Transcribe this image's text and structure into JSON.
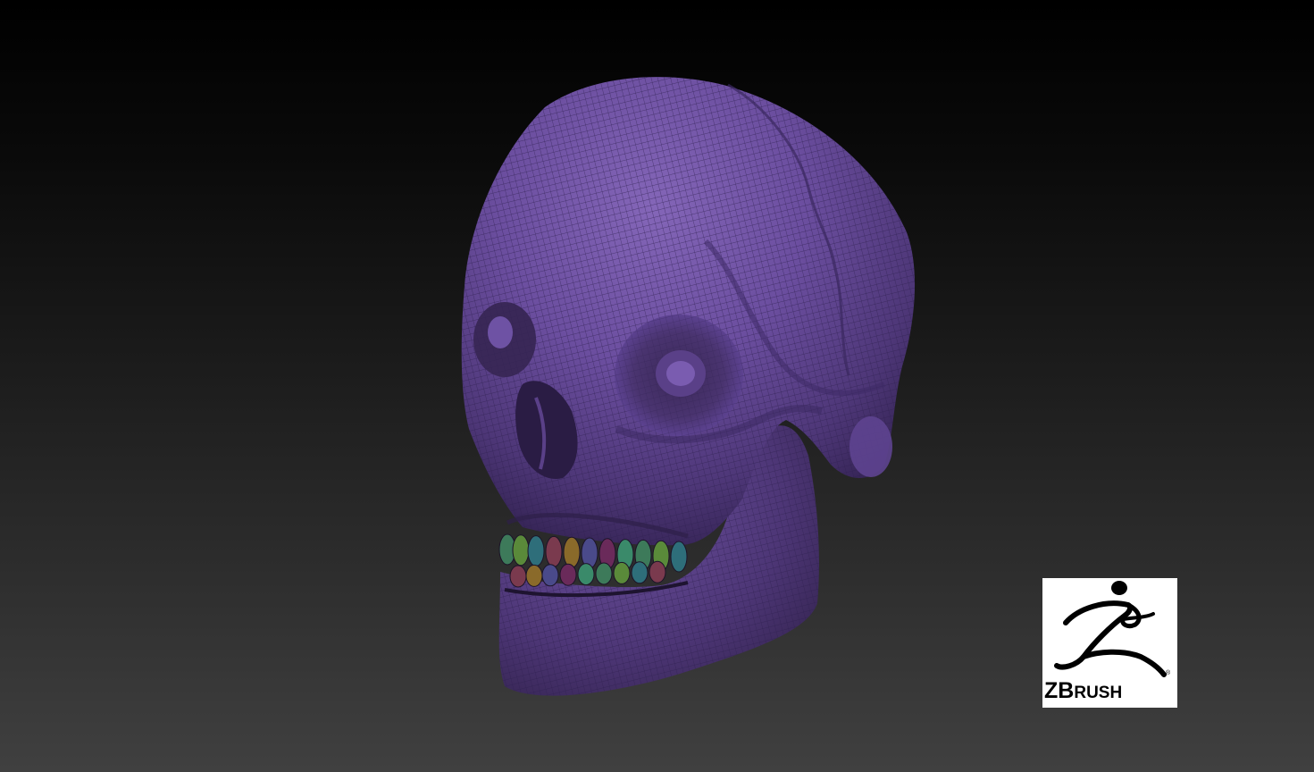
{
  "scene": {
    "background_top": "#000000",
    "background_bottom": "#404040",
    "model": {
      "subject": "human skull",
      "material_color": "#6a4a9e",
      "wireframe_color": "#3a2660",
      "teeth_polygroup_colors": [
        "#3d7a5a",
        "#5a8a3a",
        "#2e6e7a",
        "#7a3a4e",
        "#8a6a2a",
        "#4a4a8a",
        "#6a2a5a",
        "#3a8a6a"
      ]
    }
  },
  "logo": {
    "brand_parts": [
      "Z",
      "B",
      "RUSH"
    ],
    "icon": "zbrush-figure-icon",
    "registered_mark": "®"
  }
}
